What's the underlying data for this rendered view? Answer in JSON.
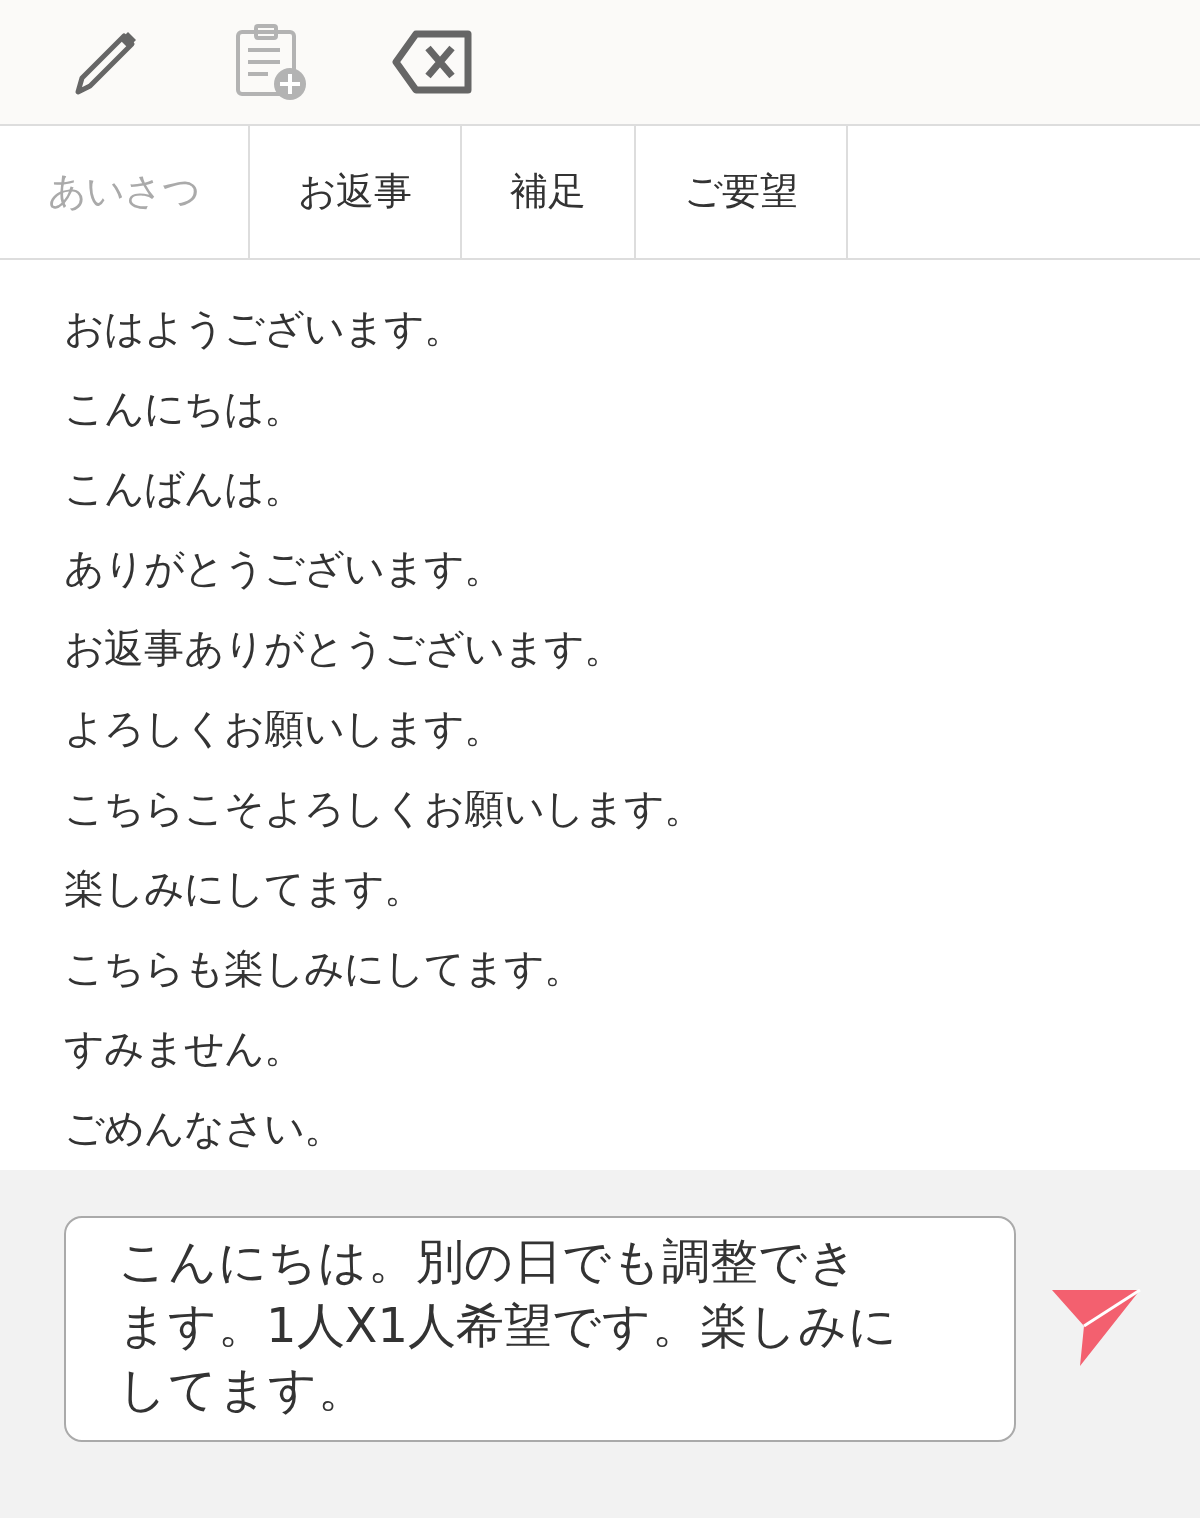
{
  "toolbar": [
    {
      "kind": "pencil",
      "disabled": false
    },
    {
      "kind": "clipboard-add",
      "disabled": true
    },
    {
      "kind": "backspace",
      "disabled": false
    }
  ],
  "tabs": [
    {
      "label": "あいさつ",
      "selected": true
    },
    {
      "label": "お返事",
      "selected": false
    },
    {
      "label": "補足",
      "selected": false
    },
    {
      "label": "ご要望",
      "selected": false
    }
  ],
  "phrases": [
    "おはようございます。",
    "こんにちは。",
    "こんばんは。",
    "ありがとうございます。",
    "お返事ありがとうございます。",
    "よろしくお願いします。",
    "こちらこそよろしくお願いします。",
    "楽しみにしてます。",
    "こちらも楽しみにしてます。",
    "すみません。",
    "ごめんなさい。"
  ],
  "composer": {
    "value": "こんにちは。別の日でも調整できます。1人X1人希望です。楽しみにしてます。"
  }
}
